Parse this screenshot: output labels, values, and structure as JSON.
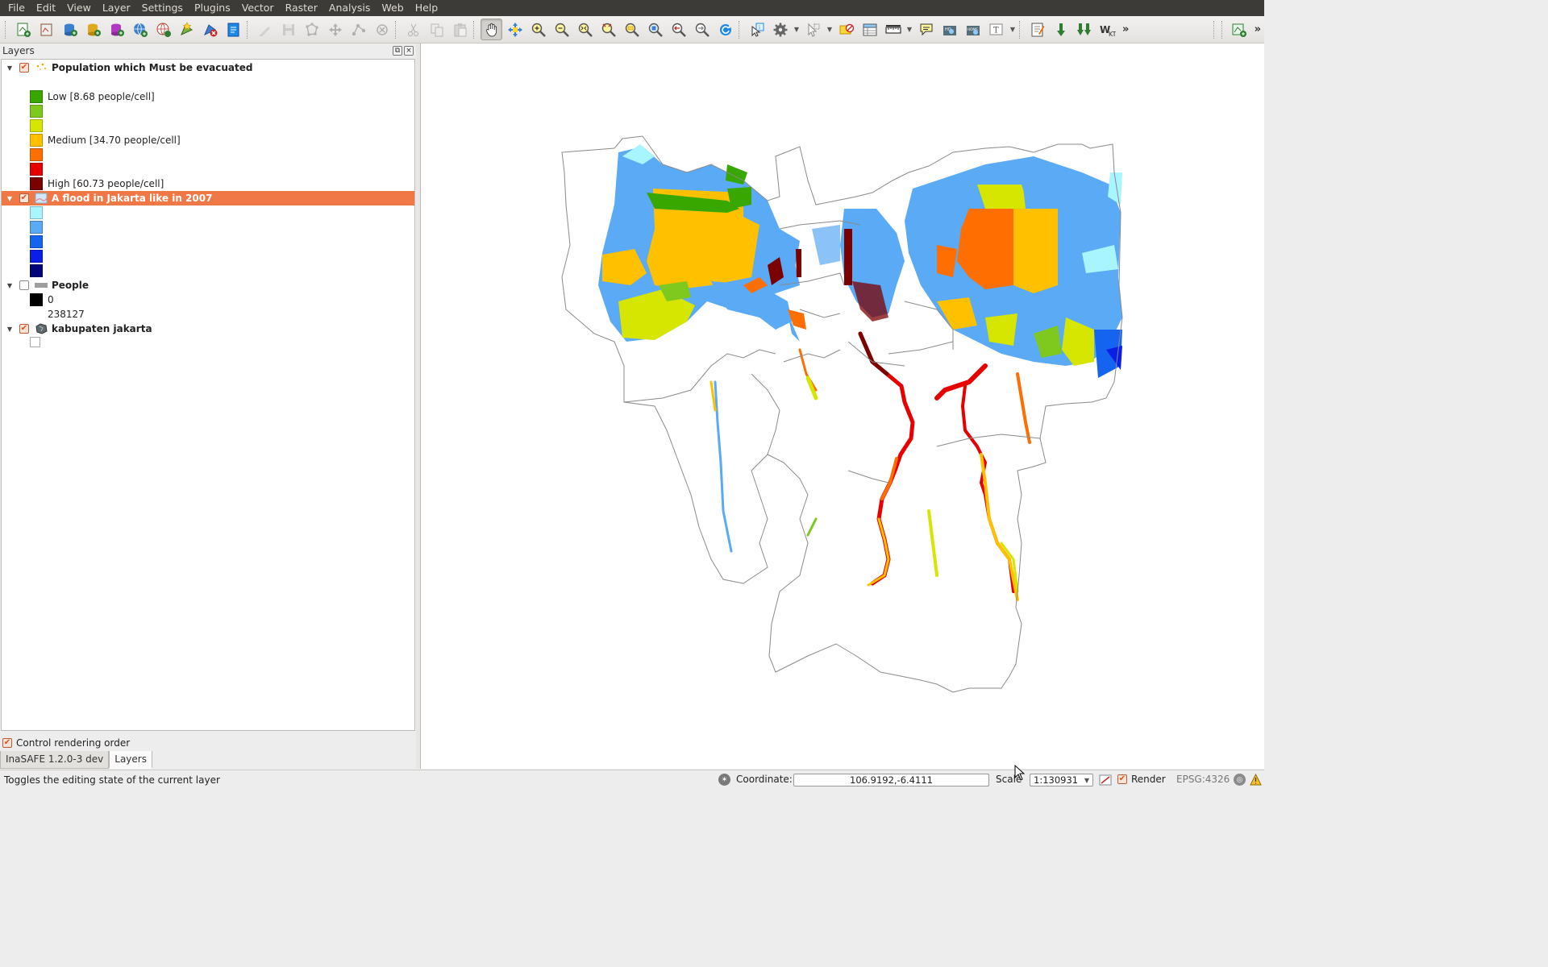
{
  "menu": [
    "File",
    "Edit",
    "View",
    "Layer",
    "Settings",
    "Plugins",
    "Vector",
    "Raster",
    "Analysis",
    "Web",
    "Help"
  ],
  "toolbar": {
    "more_symbol": "»",
    "more_symbol_right": "»"
  },
  "layers_panel": {
    "title": "Layers",
    "layers": [
      {
        "name": "Population which Must be evacuated",
        "checked": true,
        "expanded": true,
        "selected": false,
        "legend": [
          {
            "color": "#38a800",
            "label": "Low [8.68 people/cell]"
          },
          {
            "color": "#7fc81e",
            "label": ""
          },
          {
            "color": "#d7e600",
            "label": ""
          },
          {
            "color": "#ffc000",
            "label": "Medium [34.70 people/cell]"
          },
          {
            "color": "#ff6e00",
            "label": ""
          },
          {
            "color": "#e60000",
            "label": ""
          },
          {
            "color": "#7b0000",
            "label": "High [60.73 people/cell]"
          }
        ]
      },
      {
        "name": "A flood in Jakarta like in 2007",
        "checked": true,
        "expanded": true,
        "selected": true,
        "legend": [
          {
            "color": "#a8f5ff",
            "label": ""
          },
          {
            "color": "#5aaaf5",
            "label": ""
          },
          {
            "color": "#1464f0",
            "label": ""
          },
          {
            "color": "#0a1ee6",
            "label": ""
          },
          {
            "color": "#00067a",
            "label": ""
          }
        ]
      },
      {
        "name": "People",
        "checked": false,
        "expanded": true,
        "selected": false,
        "legend": [
          {
            "color": "#000000",
            "label": "0"
          },
          {
            "color": "",
            "label": "238127"
          }
        ]
      },
      {
        "name": "kabupaten jakarta",
        "checked": true,
        "expanded": true,
        "selected": false,
        "legend": [
          {
            "color": "#ffffff",
            "label": ""
          }
        ]
      }
    ],
    "control_rendering_order": {
      "label": "Control rendering order",
      "checked": true
    },
    "tabs": [
      {
        "label": "InaSAFE 1.2.0-3 dev",
        "active": false
      },
      {
        "label": "Layers",
        "active": true
      }
    ]
  },
  "statusbar": {
    "message": "Toggles the editing state of the current layer",
    "coordinate_label": "Coordinate:",
    "coordinate_value": "106.9192,-6.4111",
    "scale_label": "Scale",
    "scale_value": "1:130931",
    "render_label": "Render",
    "render_checked": true,
    "crs": "EPSG:4326"
  },
  "colors": {
    "selection": "#f07746",
    "menubar": "#3c3b37"
  }
}
